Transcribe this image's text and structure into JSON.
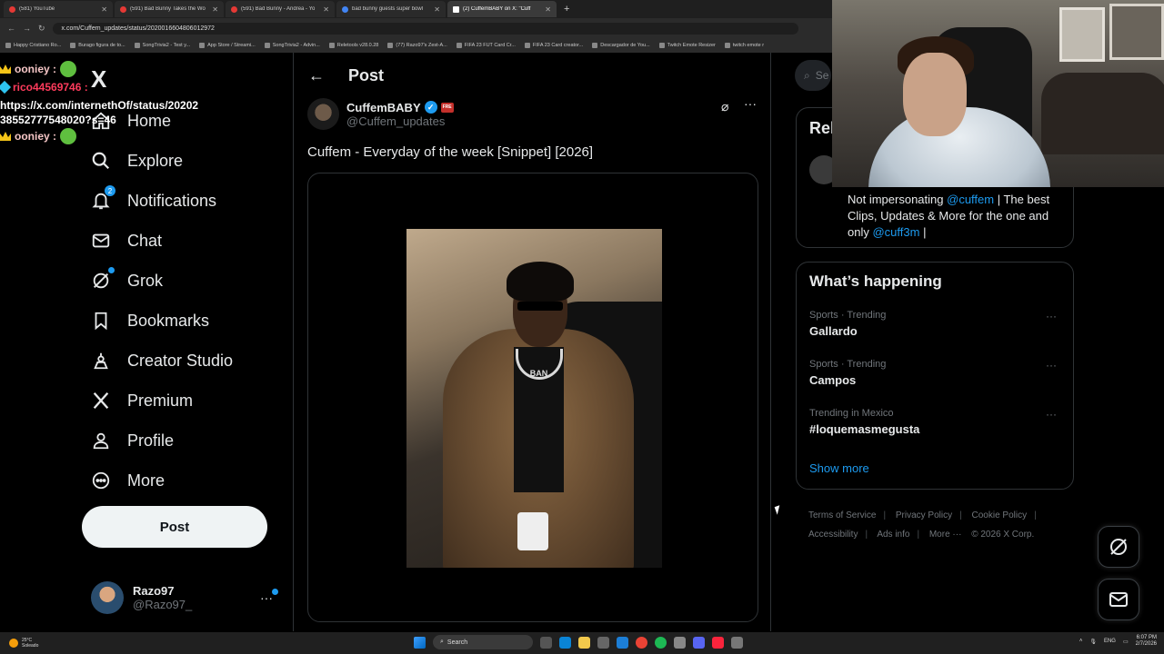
{
  "browser": {
    "tabs": [
      {
        "title": "(581) YouTube",
        "favicon": "youtube-icon",
        "active": false
      },
      {
        "title": "(591) Bad Bunny Takes the Wo",
        "favicon": "youtube-icon",
        "active": false
      },
      {
        "title": "(591) Bad Bunny - Andrea - Yo",
        "favicon": "youtube-icon",
        "active": false
      },
      {
        "title": "bad bunny guests super bowl",
        "favicon": "google-icon",
        "active": false
      },
      {
        "title": "(2) CuffemBABY on X: \"Cuff",
        "favicon": "x-icon",
        "active": true
      }
    ],
    "url": "x.com/Cuffem_updates/status/2020016604806012972",
    "bookmarks": [
      "Happy Cristiano Ro...",
      "Burago figura de to...",
      "SongTrivia2 - Test y...",
      "App Store / Streami...",
      "SongTrivia2 - Advin...",
      "Reletools v28.0.28",
      "(77) Razo97's Zest-A...",
      "FIFA 23 FUT Card Cr...",
      "FIFA 23 Card creator...",
      "Descargador de You...",
      "Twitch Emote Resizer",
      "twitch emote r"
    ]
  },
  "chat_overlay": {
    "lines": [
      {
        "user": "ooniey :",
        "type": "name-only"
      },
      {
        "user": "rico44569746 :",
        "message": "https://x.com/internethOf/status/2020238552777548020?s=46"
      },
      {
        "user": "ooniey :",
        "type": "name-only"
      }
    ]
  },
  "nav": {
    "logo": "X",
    "items": [
      {
        "label": "Home",
        "icon": "home-icon"
      },
      {
        "label": "Explore",
        "icon": "search-icon"
      },
      {
        "label": "Notifications",
        "icon": "bell-icon",
        "badge": "2"
      },
      {
        "label": "Chat",
        "icon": "mail-icon"
      },
      {
        "label": "Grok",
        "icon": "grok-icon"
      },
      {
        "label": "Bookmarks",
        "icon": "bookmark-icon"
      },
      {
        "label": "Creator Studio",
        "icon": "creator-studio-icon"
      },
      {
        "label": "Premium",
        "icon": "x-premium-icon"
      },
      {
        "label": "Profile",
        "icon": "person-icon"
      },
      {
        "label": "More",
        "icon": "more-circle-icon"
      }
    ],
    "post_button": "Post",
    "account": {
      "name": "Razo97",
      "handle": "@Razo97_"
    }
  },
  "post": {
    "header_title": "Post",
    "author_name": "CuffemBABY",
    "affiliate_badge": "FRE",
    "author_handle": "@Cuffem_updates",
    "text": "Cuffem - Everyday of the week [Snippet] [2026]",
    "media_label": "BAN"
  },
  "right": {
    "search_placeholder": "Se",
    "relevant_title": "Rel",
    "bio": {
      "prefix": "Not impersonating ",
      "mention1": "@cuffem",
      "middle": " | The best Clips, Updates & More for the one and only ",
      "mention2": "@cuff3m",
      "suffix": " |"
    },
    "happening_title": "What’s happening",
    "trends": [
      {
        "context": "Sports · Trending",
        "name": "Gallardo"
      },
      {
        "context": "Sports · Trending",
        "name": "Campos"
      },
      {
        "context": "Trending in Mexico",
        "name": "#loquemasmegusta"
      }
    ],
    "show_more": "Show more",
    "footer": {
      "terms": "Terms of Service",
      "privacy": "Privacy Policy",
      "cookie": "Cookie Policy",
      "accessibility": "Accessibility",
      "ads": "Ads info",
      "more": "More ···",
      "copyright": "© 2026 X Corp."
    }
  },
  "taskbar": {
    "weather_temp": "25°C",
    "weather_desc": "Soleado",
    "search_label": "Search",
    "lang": "ENG",
    "time": "6:07 PM",
    "date": "2/7/2026"
  },
  "colors": {
    "accent": "#1d9bf0",
    "background": "#000000",
    "border": "#2f3336",
    "muted": "#71767b"
  }
}
